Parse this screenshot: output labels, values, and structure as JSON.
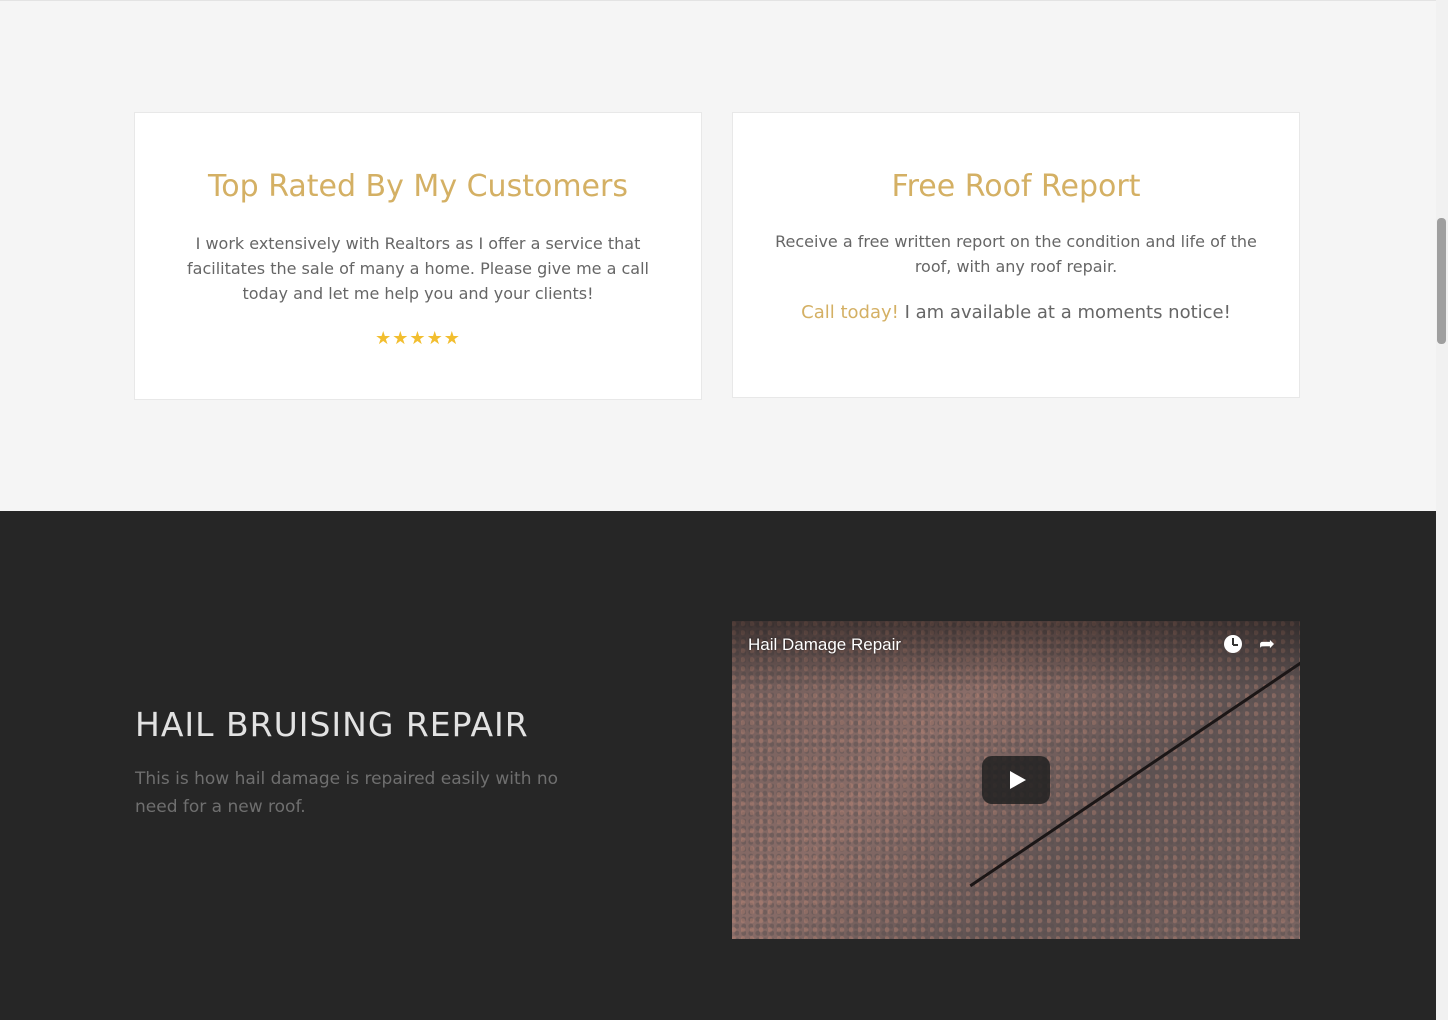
{
  "cards": [
    {
      "title": "Top Rated By My Customers",
      "text": "I work extensively with Realtors as I offer a service that facilitates the sale of many a home. Please give me a call today and let me help you and your clients!",
      "rating": 5,
      "stars": "★★★★★"
    },
    {
      "title": "Free Roof Report",
      "text": "Receive a free written report on the condition and life of the roof, with any roof repair.",
      "call_link": "Call today!",
      "call_text": " I am available at a moments notice!"
    }
  ],
  "hail": {
    "title": "HAIL BRUISING REPAIR",
    "text": "This is how hail damage is repaired easily with no need for a new roof."
  },
  "video": {
    "title": "Hail Damage Repair",
    "icons": [
      "watch-later-icon",
      "share-icon",
      "play-icon"
    ]
  },
  "colors": {
    "accent": "#d4b064",
    "dark_section": "#262626",
    "light_section": "#f5f5f5",
    "stars": "#f2be2f"
  }
}
